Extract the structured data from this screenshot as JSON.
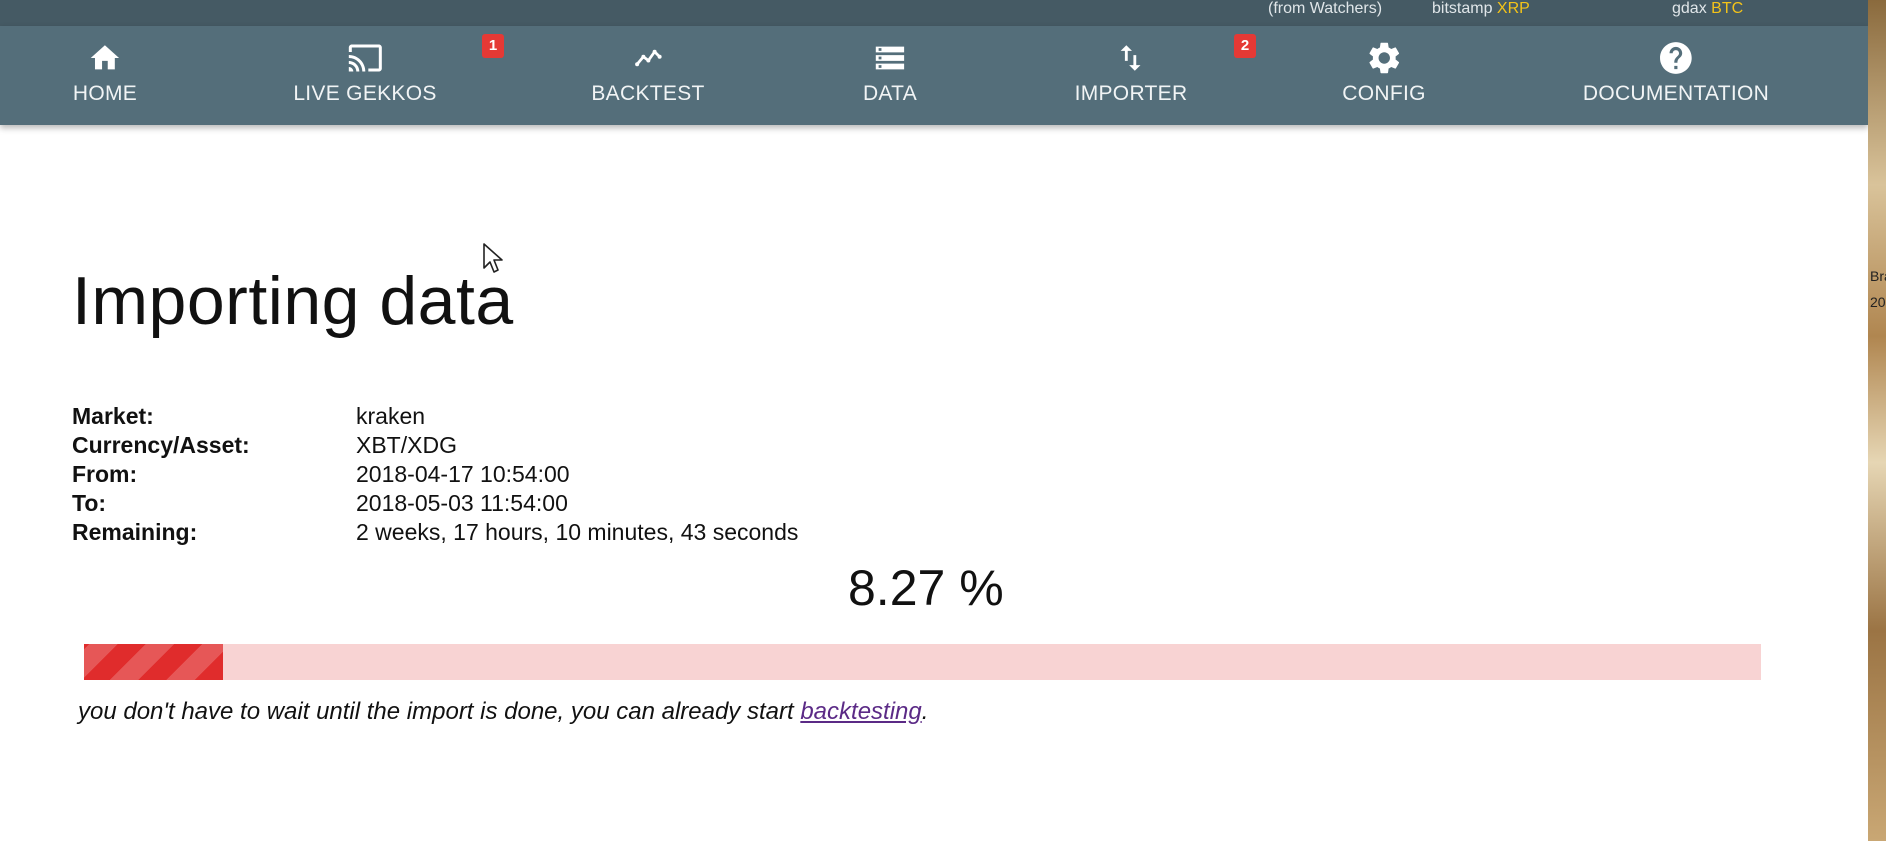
{
  "ticker": {
    "watchers": "(from Watchers)",
    "items": [
      {
        "exchange": "bitstamp",
        "asset": "XRP"
      },
      {
        "exchange": "gdax",
        "asset": "BTC"
      }
    ]
  },
  "nav": {
    "items": [
      {
        "label": "HOME",
        "icon": "home-icon"
      },
      {
        "label": "LIVE GEKKOS",
        "icon": "cast-icon",
        "badge": "1"
      },
      {
        "label": "BACKTEST",
        "icon": "line-chart-icon"
      },
      {
        "label": "DATA",
        "icon": "storage-icon"
      },
      {
        "label": "IMPORTER",
        "icon": "import-export-icon",
        "badge": "2"
      },
      {
        "label": "CONFIG",
        "icon": "gear-icon"
      },
      {
        "label": "DOCUMENTATION",
        "icon": "help-icon"
      }
    ]
  },
  "page": {
    "title": "Importing data"
  },
  "import": {
    "rows": [
      {
        "label": "Market:",
        "value": "kraken"
      },
      {
        "label": "Currency/Asset:",
        "value": "XBT/XDG"
      },
      {
        "label": "From:",
        "value": "2018-04-17 10:54:00"
      },
      {
        "label": "To:",
        "value": "2018-05-03 11:54:00"
      },
      {
        "label": "Remaining:",
        "value": "2 weeks, 17 hours, 10 minutes, 43 seconds"
      }
    ],
    "percent_text": "8.27 %",
    "progress": 0.0827
  },
  "note": {
    "before": "you don't have to wait until the import is done, you can already start ",
    "link": "backtesting",
    "after": "."
  },
  "colors": {
    "ticker_bg": "#455a64",
    "nav_bg": "#546e7a",
    "accent": "#f3c319",
    "badge": "#e53935",
    "progress_fill": "#e02c2c",
    "progress_track": "#f8d3d3",
    "link": "#5b2a86"
  }
}
